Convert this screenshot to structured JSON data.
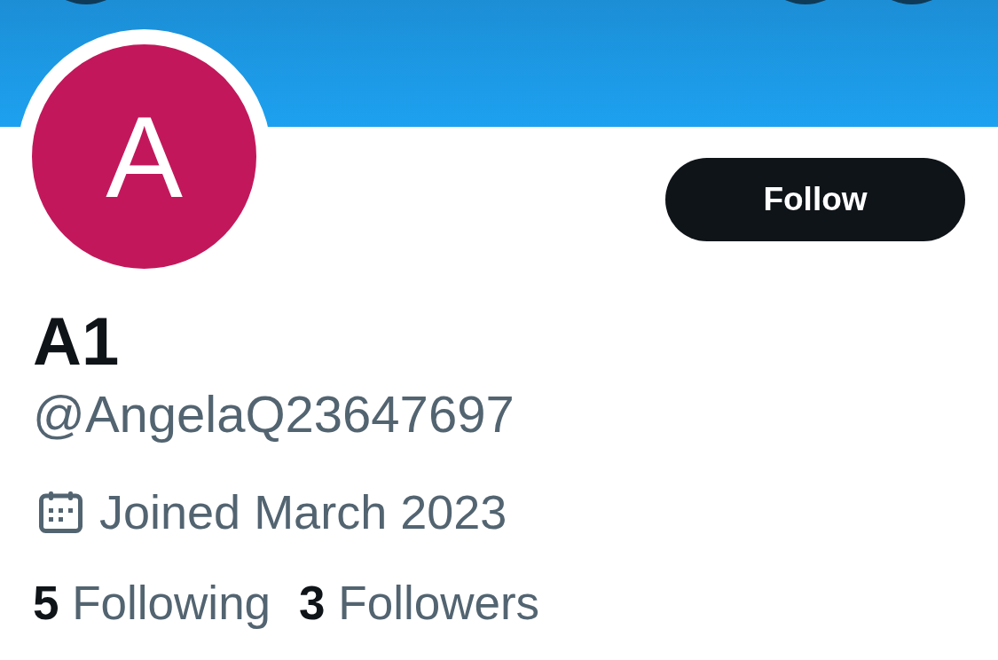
{
  "profile": {
    "avatar_initial": "A",
    "display_name": "A1",
    "handle": "@AngelaQ23647697",
    "joined": "Joined March 2023",
    "stats": [
      {
        "count": "5",
        "label": "Following"
      },
      {
        "count": "3",
        "label": "Followers"
      }
    ]
  },
  "follow_button": {
    "label": "Follow"
  }
}
